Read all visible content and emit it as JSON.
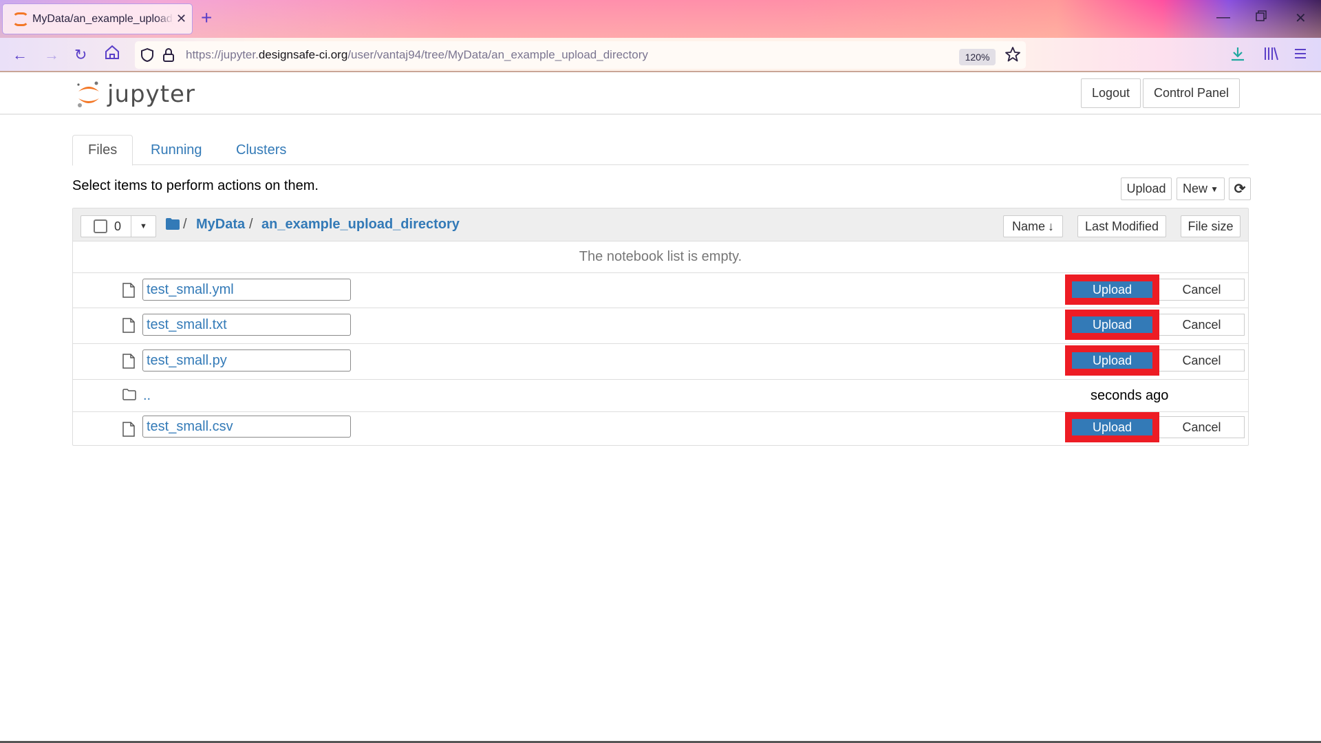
{
  "browser": {
    "tab_title": "MyData/an_example_upload_directory",
    "url_prefix": "https://jupyter.",
    "url_host": "designsafe-ci.org",
    "url_path": "/user/vantaj94/tree/MyData/an_example_upload_directory",
    "zoom": "120%",
    "icons": [
      "back-icon",
      "forward-icon",
      "reload-icon",
      "home-icon",
      "shield-icon",
      "lock-icon",
      "star-icon",
      "download-icon",
      "library-icon",
      "menu-icon",
      "minimize-icon",
      "restore-icon",
      "close-icon"
    ]
  },
  "header": {
    "logo_text": "jupyter",
    "logout": "Logout",
    "control_panel": "Control Panel"
  },
  "tabs": [
    {
      "label": "Files",
      "active": true
    },
    {
      "label": "Running",
      "active": false
    },
    {
      "label": "Clusters",
      "active": false
    }
  ],
  "toolbar": {
    "hint": "Select items to perform actions on them.",
    "upload": "Upload",
    "new": "New"
  },
  "list_header": {
    "selected_count": "0",
    "breadcrumb_root_sep": "/",
    "breadcrumb": [
      "MyData",
      "an_example_upload_directory"
    ],
    "sort_name": "Name",
    "sort_modified": "Last Modified",
    "sort_size": "File size"
  },
  "empty_message": "The notebook list is empty.",
  "rows": [
    {
      "type": "pending-upload",
      "name": "test_small.yml",
      "upload": "Upload",
      "cancel": "Cancel"
    },
    {
      "type": "pending-upload",
      "name": "test_small.txt",
      "upload": "Upload",
      "cancel": "Cancel"
    },
    {
      "type": "pending-upload",
      "name": "test_small.py",
      "upload": "Upload",
      "cancel": "Cancel"
    },
    {
      "type": "parent-folder",
      "name": "..",
      "modified": "seconds ago"
    },
    {
      "type": "pending-upload",
      "name": "test_small.csv",
      "upload": "Upload",
      "cancel": "Cancel"
    }
  ],
  "colors": {
    "link": "#337ab7",
    "highlight": "#ed1c24",
    "jupyter_orange": "#f37726"
  }
}
